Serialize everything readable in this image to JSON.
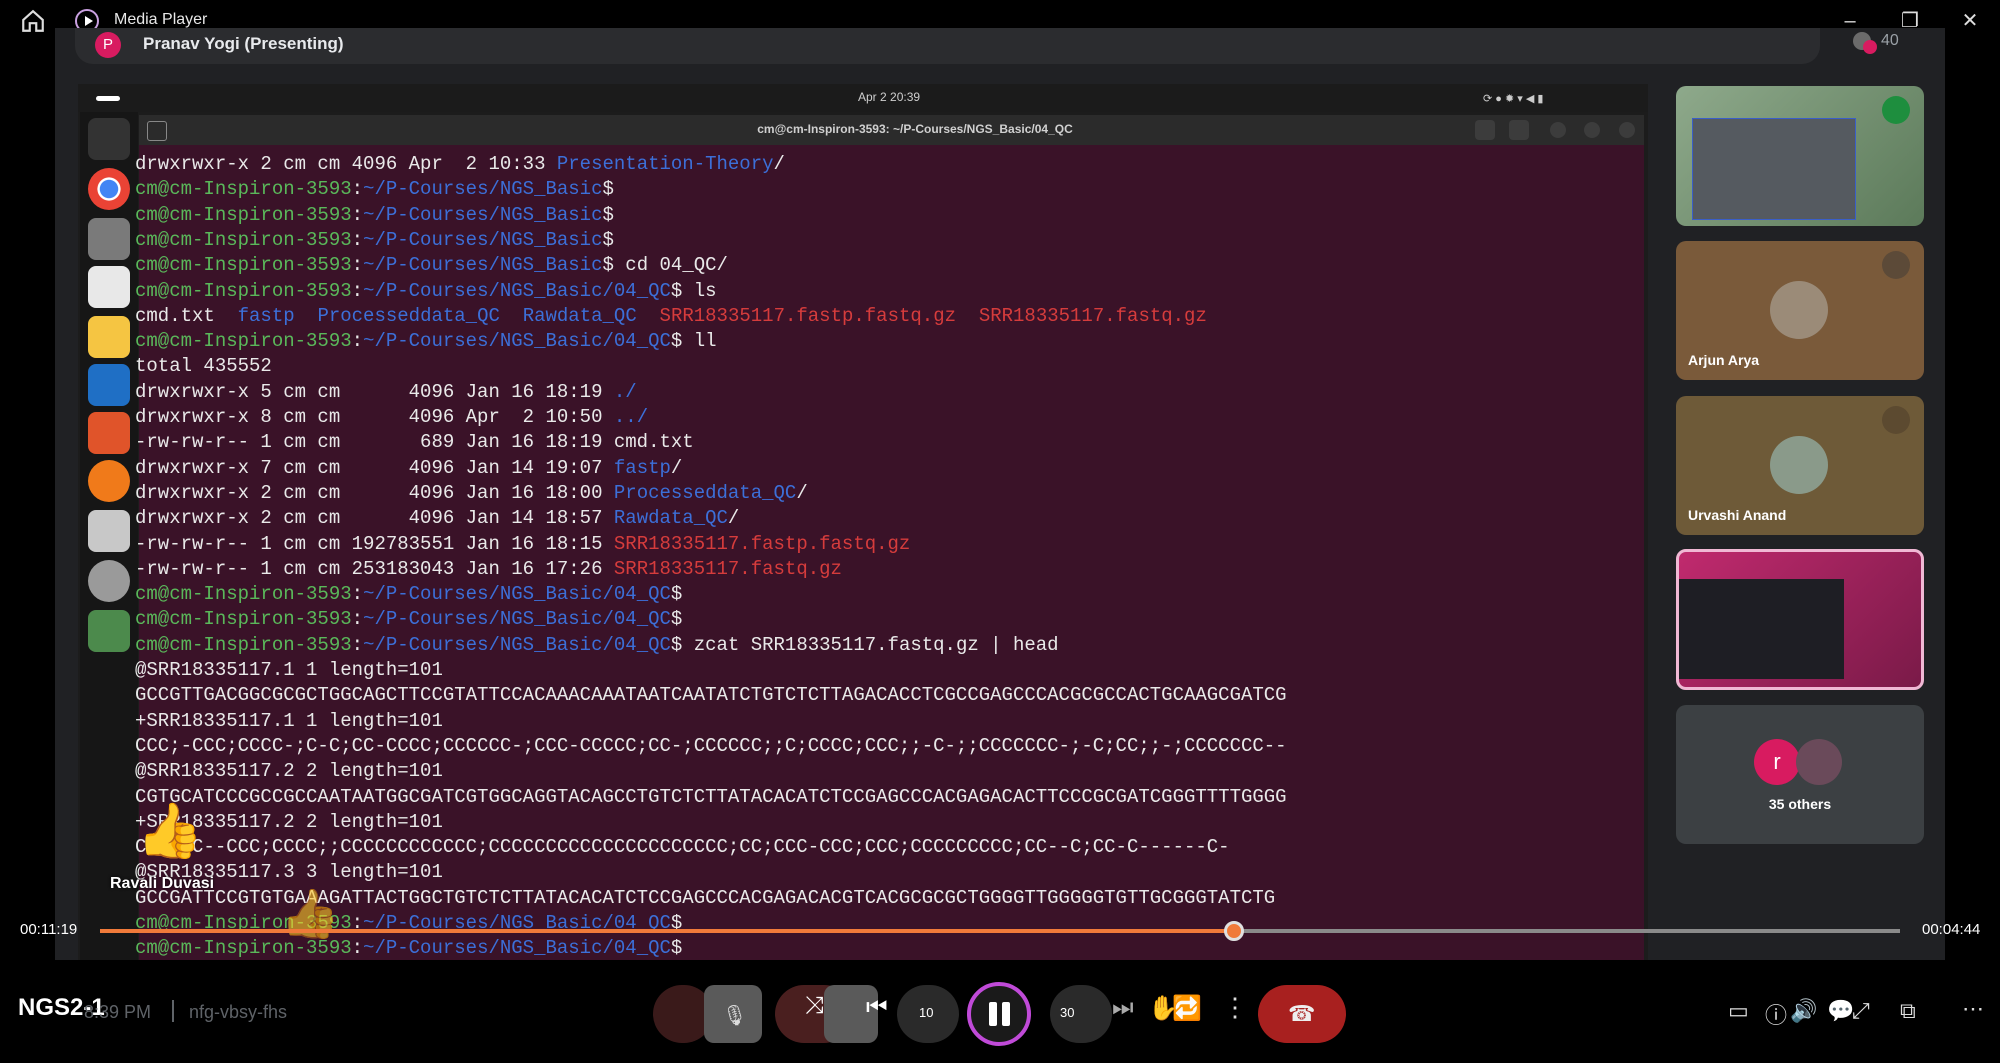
{
  "window": {
    "title": "Media Player"
  },
  "presenter": {
    "initial": "P",
    "name": "Pranav Yogi (Presenting)",
    "count": "40"
  },
  "screen": {
    "clock": "Apr 2  20:39",
    "terminal_title": "cm@cm-Inspiron-3593: ~/P-Courses/NGS_Basic/04_QC"
  },
  "terminal_lines": [
    [
      {
        "t": "drwxrwxr-x 2 cm cm 4096 Apr  2 10:33 ",
        "c": ""
      },
      {
        "t": "Presentation-Theory",
        "c": "b"
      },
      {
        "t": "/",
        "c": ""
      }
    ],
    [
      {
        "t": "cm@cm-Inspiron-3593",
        "c": "g"
      },
      {
        "t": ":",
        "c": ""
      },
      {
        "t": "~/P-Courses/NGS_Basic",
        "c": "b"
      },
      {
        "t": "$",
        "c": ""
      }
    ],
    [
      {
        "t": "cm@cm-Inspiron-3593",
        "c": "g"
      },
      {
        "t": ":",
        "c": ""
      },
      {
        "t": "~/P-Courses/NGS_Basic",
        "c": "b"
      },
      {
        "t": "$",
        "c": ""
      }
    ],
    [
      {
        "t": "cm@cm-Inspiron-3593",
        "c": "g"
      },
      {
        "t": ":",
        "c": ""
      },
      {
        "t": "~/P-Courses/NGS_Basic",
        "c": "b"
      },
      {
        "t": "$",
        "c": ""
      }
    ],
    [
      {
        "t": "cm@cm-Inspiron-3593",
        "c": "g"
      },
      {
        "t": ":",
        "c": ""
      },
      {
        "t": "~/P-Courses/NGS_Basic",
        "c": "b"
      },
      {
        "t": "$ cd 04_QC/",
        "c": ""
      }
    ],
    [
      {
        "t": "cm@cm-Inspiron-3593",
        "c": "g"
      },
      {
        "t": ":",
        "c": ""
      },
      {
        "t": "~/P-Courses/NGS_Basic/04_QC",
        "c": "b"
      },
      {
        "t": "$ ls",
        "c": ""
      }
    ],
    [
      {
        "t": "cmd.txt  ",
        "c": ""
      },
      {
        "t": "fastp",
        "c": "b"
      },
      {
        "t": "  ",
        "c": ""
      },
      {
        "t": "Processeddata_QC",
        "c": "b"
      },
      {
        "t": "  ",
        "c": ""
      },
      {
        "t": "Rawdata_QC",
        "c": "b"
      },
      {
        "t": "  ",
        "c": ""
      },
      {
        "t": "SRR18335117.fastp.fastq.gz",
        "c": "r"
      },
      {
        "t": "  ",
        "c": ""
      },
      {
        "t": "SRR18335117.fastq.gz",
        "c": "r"
      }
    ],
    [
      {
        "t": "cm@cm-Inspiron-3593",
        "c": "g"
      },
      {
        "t": ":",
        "c": ""
      },
      {
        "t": "~/P-Courses/NGS_Basic/04_QC",
        "c": "b"
      },
      {
        "t": "$ ll",
        "c": ""
      }
    ],
    [
      {
        "t": "total 435552",
        "c": ""
      }
    ],
    [
      {
        "t": "drwxrwxr-x 5 cm cm      4096 Jan 16 18:19 ",
        "c": ""
      },
      {
        "t": "./",
        "c": "b"
      }
    ],
    [
      {
        "t": "drwxrwxr-x 8 cm cm      4096 Apr  2 10:50 ",
        "c": ""
      },
      {
        "t": "../",
        "c": "b"
      }
    ],
    [
      {
        "t": "-rw-rw-r-- 1 cm cm       689 Jan 16 18:19 cmd.txt",
        "c": ""
      }
    ],
    [
      {
        "t": "drwxrwxr-x 7 cm cm      4096 Jan 14 19:07 ",
        "c": ""
      },
      {
        "t": "fastp",
        "c": "b"
      },
      {
        "t": "/",
        "c": ""
      }
    ],
    [
      {
        "t": "drwxrwxr-x 2 cm cm      4096 Jan 16 18:00 ",
        "c": ""
      },
      {
        "t": "Processeddata_QC",
        "c": "b"
      },
      {
        "t": "/",
        "c": ""
      }
    ],
    [
      {
        "t": "drwxrwxr-x 2 cm cm      4096 Jan 14 18:57 ",
        "c": ""
      },
      {
        "t": "Rawdata_QC",
        "c": "b"
      },
      {
        "t": "/",
        "c": ""
      }
    ],
    [
      {
        "t": "-rw-rw-r-- 1 cm cm 192783551 Jan 16 18:15 ",
        "c": ""
      },
      {
        "t": "SRR18335117.fastp.fastq.gz",
        "c": "r"
      }
    ],
    [
      {
        "t": "-rw-rw-r-- 1 cm cm 253183043 Jan 16 17:26 ",
        "c": ""
      },
      {
        "t": "SRR18335117.fastq.gz",
        "c": "r"
      }
    ],
    [
      {
        "t": "cm@cm-Inspiron-3593",
        "c": "g"
      },
      {
        "t": ":",
        "c": ""
      },
      {
        "t": "~/P-Courses/NGS_Basic/04_QC",
        "c": "b"
      },
      {
        "t": "$",
        "c": ""
      }
    ],
    [
      {
        "t": "cm@cm-Inspiron-3593",
        "c": "g"
      },
      {
        "t": ":",
        "c": ""
      },
      {
        "t": "~/P-Courses/NGS_Basic/04_QC",
        "c": "b"
      },
      {
        "t": "$",
        "c": ""
      }
    ],
    [
      {
        "t": "cm@cm-Inspiron-3593",
        "c": "g"
      },
      {
        "t": ":",
        "c": ""
      },
      {
        "t": "~/P-Courses/NGS_Basic/04_QC",
        "c": "b"
      },
      {
        "t": "$ zcat SRR18335117.fastq.gz | head",
        "c": ""
      }
    ],
    [
      {
        "t": "@SRR18335117.1 1 length=101",
        "c": ""
      }
    ],
    [
      {
        "t": "GCCGTTGACGGCGCGCTGGCAGCTTCCGTATTCCACAAACAAATAATCAATATCTGTCTCTTAGACACCTCGCCGAGCCCACGCGCCACTGCAAGCGATCG",
        "c": ""
      }
    ],
    [
      {
        "t": "+SRR18335117.1 1 length=101",
        "c": ""
      }
    ],
    [
      {
        "t": "CCC;-CCC;CCCC-;C-C;CC-CCCC;CCCCCC-;CCC-CCCCC;CC-;CCCCCC;;C;CCCC;CCC;;-C-;;CCCCCCC-;-C;CC;;-;CCCCCCC--",
        "c": ""
      }
    ],
    [
      {
        "t": "@SRR18335117.2 2 length=101",
        "c": ""
      }
    ],
    [
      {
        "t": "CGTGCATCCCGCCGCCAATAATGGCGATCGTGGCAGGTACAGCCTGTCTCTTATACACATCTCCGAGCCCACGAGACACTTCCCGCGATCGGGTTTTGGGG",
        "c": ""
      }
    ],
    [
      {
        "t": "+SRR18335117.2 2 length=101",
        "c": ""
      }
    ],
    [
      {
        "t": "CCCCCC--CCC;CCCC;;CCCCCCCCCCCC;CCCCCCCCCCCCCCCCCCCCC;CC;CCC-CCC;CCC;CCCCCCCCC;CC--C;CC-C------C-",
        "c": ""
      }
    ],
    [
      {
        "t": "@SRR18335117.3 3 length=101",
        "c": ""
      }
    ],
    [
      {
        "t": "GCCGATTCCGTGTGAAAGATTACTGGCTGTCTCTTATACACATCTCCGAGCCCACGAGACACGTCACGCGCGCTGGGGTTGGGGGTGTTGCGGGTATCTG",
        "c": ""
      }
    ],
    [
      {
        "t": "cm@cm-Inspiron-3593",
        "c": "g"
      },
      {
        "t": ":",
        "c": ""
      },
      {
        "t": "~/P-Courses/NGS_Basic/04_QC",
        "c": "b"
      },
      {
        "t": "$",
        "c": ""
      }
    ],
    [
      {
        "t": "cm@cm-Inspiron-3593",
        "c": "g"
      },
      {
        "t": ":",
        "c": ""
      },
      {
        "t": "~/P-Courses/NGS_Basic/04_QC",
        "c": "b"
      },
      {
        "t": "$",
        "c": ""
      }
    ]
  ],
  "participants": {
    "arjun": "Arjun Arya",
    "urvashi": "Urvashi Anand",
    "others_initial": "r",
    "others": "35 others"
  },
  "reaction": {
    "name": "Ravali Duvasi",
    "emoji": "👍"
  },
  "player": {
    "elapsed": "00:11:19",
    "remaining": "00:04:44",
    "progress": 0.63,
    "meeting_name": "NGS2-1",
    "meeting_time": "8:39 PM",
    "meeting_code": "nfg-vbsy-fhs",
    "skip_back": "10",
    "skip_forward": "30"
  }
}
